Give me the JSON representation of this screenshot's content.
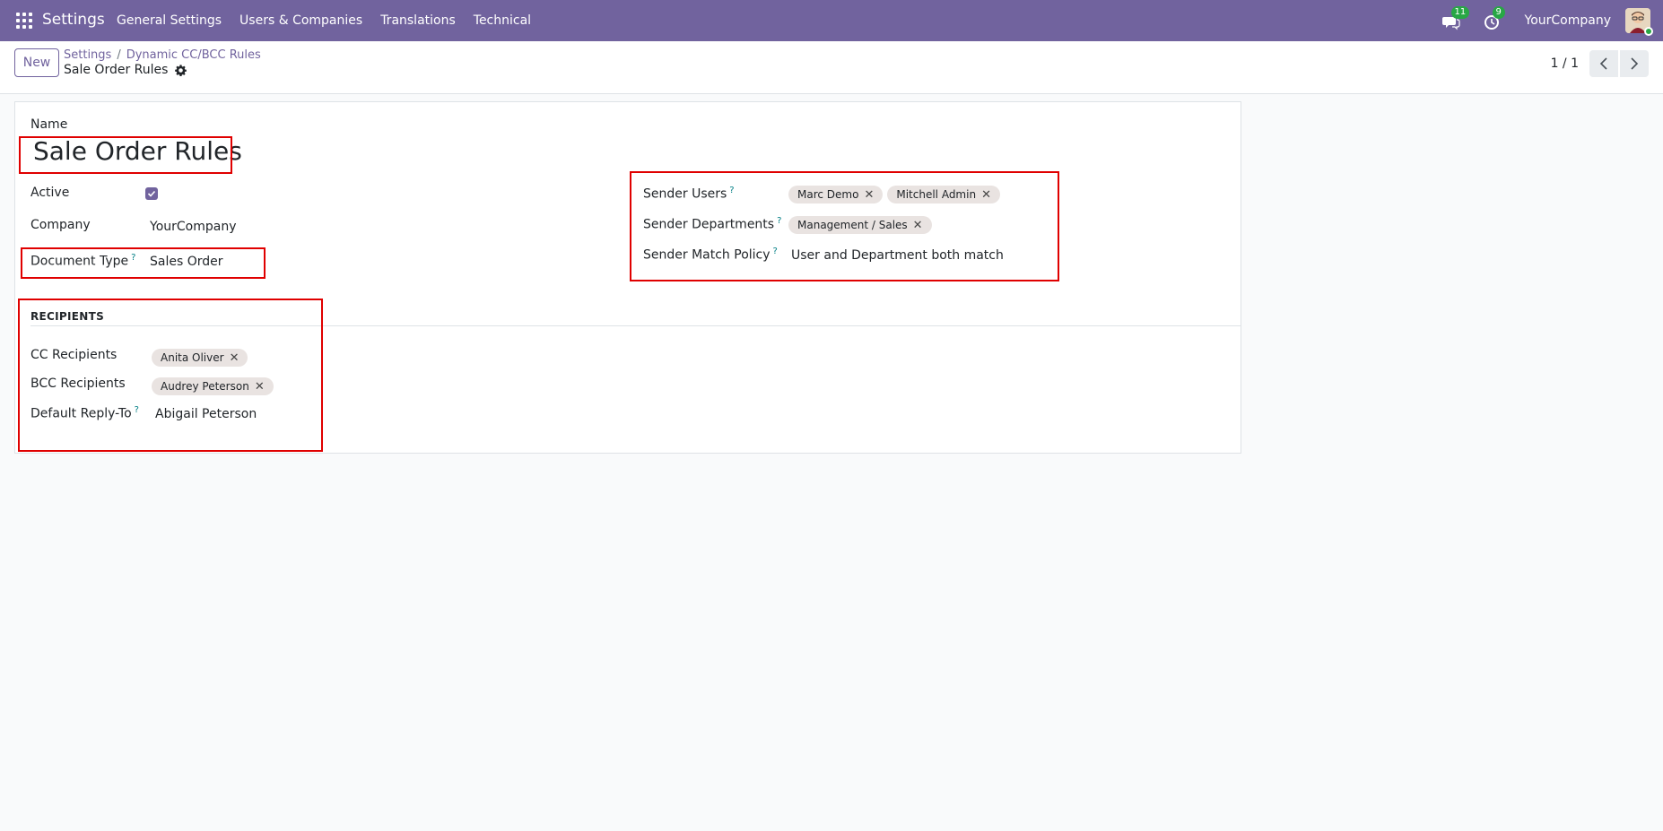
{
  "navbar": {
    "app_title": "Settings",
    "menu": [
      "General Settings",
      "Users & Companies",
      "Translations",
      "Technical"
    ],
    "messages_count": "11",
    "activities_count": "9",
    "company": "YourCompany"
  },
  "control_panel": {
    "new_label": "New",
    "breadcrumb": [
      "Settings",
      "Dynamic CC/BCC Rules"
    ],
    "breadcrumb_sep": "/",
    "record_title": "Sale Order Rules",
    "pager": "1 / 1"
  },
  "form": {
    "name_label": "Name",
    "name_value": "Sale Order Rules",
    "active_label": "Active",
    "active_checked": true,
    "company_label": "Company",
    "company_value": "YourCompany",
    "document_type_label": "Document Type",
    "document_type_value": "Sales Order",
    "help_marker": "?",
    "sender_users_label": "Sender Users",
    "sender_users": [
      "Marc Demo",
      "Mitchell Admin"
    ],
    "sender_departments_label": "Sender Departments",
    "sender_departments": [
      "Management / Sales"
    ],
    "sender_match_policy_label": "Sender Match Policy",
    "sender_match_policy_value": "User and Department both match",
    "recipients_section": "RECIPIENTS",
    "cc_label": "CC Recipients",
    "cc_recipients": [
      "Anita Oliver"
    ],
    "bcc_label": "BCC Recipients",
    "bcc_recipients": [
      "Audrey Peterson"
    ],
    "reply_to_label": "Default Reply-To",
    "reply_to_value": "Abigail Peterson"
  },
  "colors": {
    "brand": "#71639e",
    "highlight": "#e00000",
    "badge": "#28a745"
  }
}
